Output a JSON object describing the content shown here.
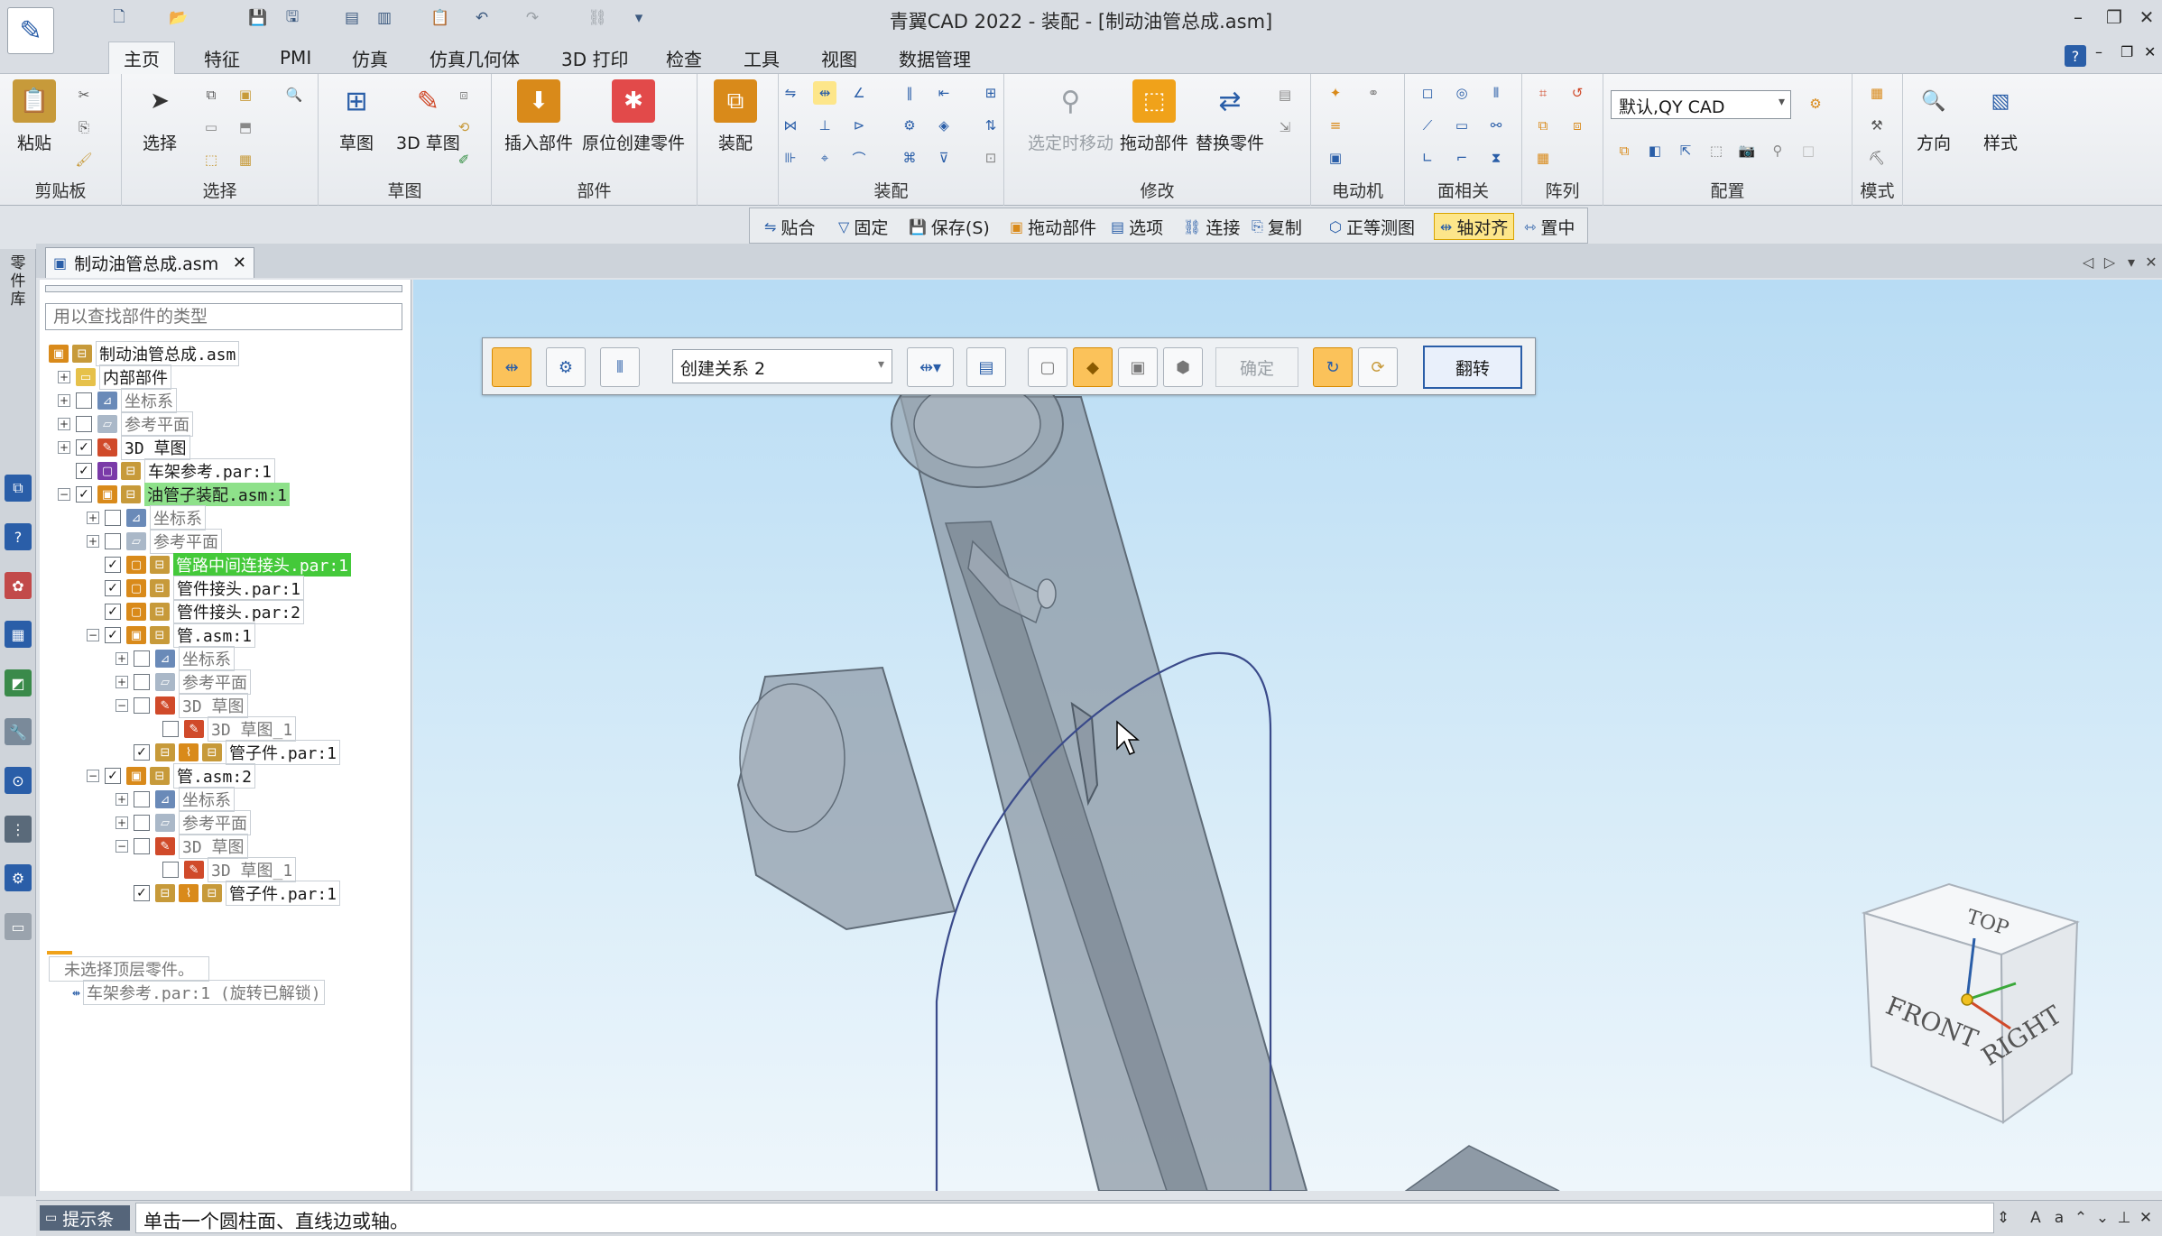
{
  "window": {
    "title": "青翼CAD 2022 - 装配 - [制动油管总成.asm]",
    "minimize": "–",
    "restore": "❐",
    "close": "✕"
  },
  "quick_access": [
    "new",
    "open",
    "save",
    "undo",
    "redo"
  ],
  "menu_tabs": [
    "主页",
    "特征",
    "PMI",
    "仿真",
    "仿真几何体",
    "3D 打印",
    "检查",
    "工具",
    "视图",
    "数据管理"
  ],
  "ribbon": {
    "clipboard": {
      "label": "剪贴板",
      "paste": "粘贴"
    },
    "select": {
      "label": "选择",
      "select": "选择"
    },
    "sketch": {
      "label": "草图",
      "sketch": "草图",
      "sketch3d": "3D 草图"
    },
    "parts": {
      "label": "部件",
      "insert": "插入部件",
      "create_in_place": "原位创建零件"
    },
    "assemble": {
      "label": "装配",
      "assemble": "装配"
    },
    "modify": {
      "label": "修改",
      "move_when_selected": "选定时移动",
      "drag": "拖动部件",
      "replace": "替换零件"
    },
    "motor": {
      "label": "电动机"
    },
    "face": {
      "label": "面相关"
    },
    "pattern": {
      "label": "阵列"
    },
    "config": {
      "label": "配置",
      "value": "默认,QY CAD"
    },
    "mode": {
      "label": "模式"
    },
    "orient": {
      "label": "方向"
    },
    "style": {
      "label": "样式"
    }
  },
  "cmdbar": {
    "mate": "贴合",
    "fix": "固定",
    "save": "保存(S)",
    "drag": "拖动部件",
    "options": "选项",
    "connect": "连接",
    "copy": "复制",
    "iso": "正等测图",
    "axis_align": "轴对齐",
    "center": "置中"
  },
  "doc_tab": {
    "name": "制动油管总成.asm"
  },
  "side_strip": {
    "label": "零件库"
  },
  "tree": {
    "search_placeholder": "用以查找部件的类型",
    "root": "制动油管总成.asm",
    "internal": "内部部件",
    "coord": "坐标系",
    "refplane": "参考平面",
    "sketch3d": "3D 草图",
    "frame": "车架参考.par:1",
    "subasm": "油管子装配.asm:1",
    "sub_coord": "坐标系",
    "sub_ref": "参考平面",
    "connector": "管路中间连接头.par:1",
    "fitting1": "管件接头.par:1",
    "fitting2": "管件接头.par:2",
    "pipe1": "管.asm:1",
    "p1_coord": "坐标系",
    "p1_ref": "参考平面",
    "p1_sketch": "3D 草图",
    "p1_sketch1": "3D 草图_1",
    "p1_part": "管子件.par:1",
    "pipe2": "管.asm:2",
    "p2_coord": "坐标系",
    "p2_ref": "参考平面",
    "p2_sketch": "3D 草图",
    "p2_sketch1": "3D 草图_1",
    "p2_part": "管子件.par:1",
    "status1": "未选择顶层零件。",
    "status2": "车架参考.par:1  (旋转已解锁)"
  },
  "assemble_bar": {
    "relation": "创建关系 2",
    "ok": "确定",
    "flip": "翻转"
  },
  "view_cube": {
    "top": "TOP",
    "front": "FRONT",
    "right": "RIGHT"
  },
  "status": {
    "prompt_label": "提示条",
    "prompt_text": "单击一个圆柱面、直线边或轴。"
  },
  "colors": {
    "accent": "#2a5ea8",
    "highlight_green": "#8ee18a",
    "highlight_bright": "#44c93a",
    "active_yellow": "#fde68a",
    "part_gray": "#8e9aa6"
  }
}
